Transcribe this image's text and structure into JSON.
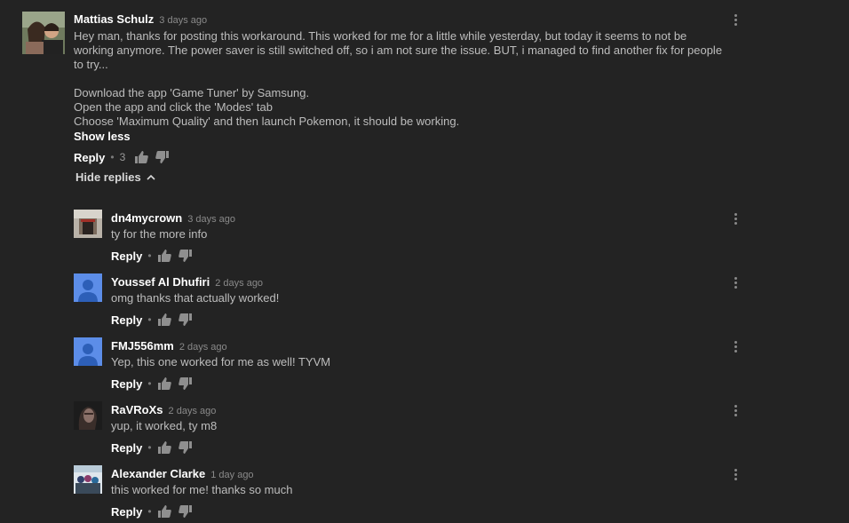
{
  "main_comment": {
    "author": "Mattias Schulz",
    "time": "3 days ago",
    "text": "Hey man, thanks for posting this workaround. This worked for me for a little while yesterday, but today it seems to not be working anymore. The power saver is still switched off, so i am not sure the issue. BUT, i managed to find another fix for people to try...\n\nDownload the app 'Game Tuner' by Samsung.\nOpen the app and click the 'Modes' tab\nChoose 'Maximum Quality' and then launch Pokemon, it should be working.",
    "show_less": "Show less",
    "reply_label": "Reply",
    "like_count": "3",
    "hide_replies": "Hide replies"
  },
  "replies": [
    {
      "author": "dn4mycrown",
      "time": "3 days ago",
      "text": "ty for the more info",
      "reply_label": "Reply",
      "avatar": "photo-building"
    },
    {
      "author": "Youssef Al Dhufiri",
      "time": "2 days ago",
      "text": "omg thanks that actually worked!",
      "reply_label": "Reply",
      "avatar": "default-user-icon"
    },
    {
      "author": "FMJ556mm",
      "time": "2 days ago",
      "text": "Yep, this one worked for me as well! TYVM",
      "reply_label": "Reply",
      "avatar": "default-user-icon"
    },
    {
      "author": "RaVRoXs",
      "time": "2 days ago",
      "text": "yup, it worked, ty m8",
      "reply_label": "Reply",
      "avatar": "photo-portrait"
    },
    {
      "author": "Alexander Clarke",
      "time": "1 day ago",
      "text": "this worked for me! thanks so much",
      "reply_label": "Reply",
      "avatar": "photo-group"
    }
  ],
  "colors": {
    "background": "#232323",
    "author": "#ffffff",
    "text": "#bdbdbd",
    "meta": "#8a8a8a",
    "default_avatar_bg": "#5c8de8"
  },
  "icons": {
    "like": "thumbs-up-icon",
    "dislike": "thumbs-down-icon",
    "menu": "more-vert-icon",
    "chevron": "chevron-up-icon"
  }
}
